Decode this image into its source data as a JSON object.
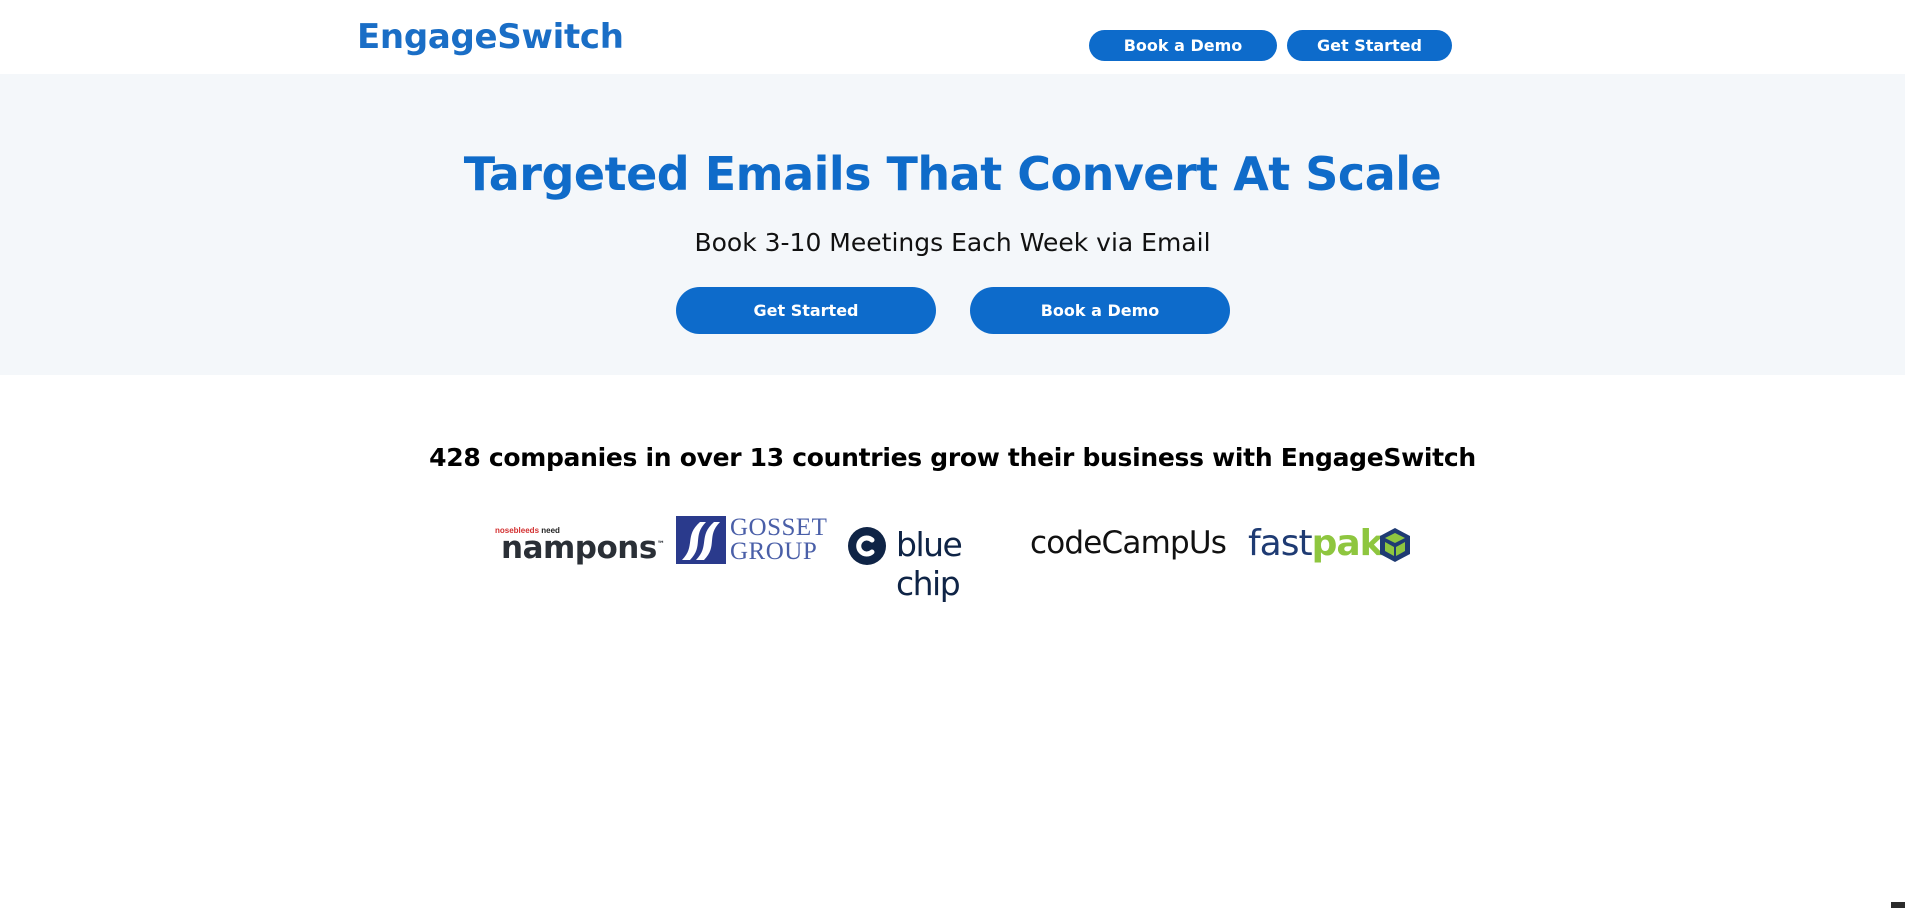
{
  "header": {
    "brand": "EngageSwitch",
    "nav": {
      "book_demo": "Book a Demo",
      "get_started": "Get Started"
    }
  },
  "hero": {
    "title": "Targeted Emails That Convert At Scale",
    "subtitle": "Book 3-10 Meetings Each Week via Email",
    "buttons": {
      "get_started": "Get Started",
      "book_demo": "Book a Demo"
    }
  },
  "social_proof": {
    "headline": "428 companies in over 13 countries grow their business with EngageSwitch",
    "logos": {
      "nampons": {
        "tagline_red": "nosebleeds",
        "tagline_dark": "need",
        "name": "nampons",
        "tm": "™"
      },
      "gosset": {
        "line1": "GOSSET",
        "line2": "GROUP"
      },
      "bluechip": {
        "name": "blue chip"
      },
      "codecampus": {
        "name": "codeCampUs"
      },
      "fastpak": {
        "part1": "fast",
        "part2": "pak"
      }
    }
  },
  "colors": {
    "brand_blue": "#1a6ec6",
    "button_blue": "#0d6bcb",
    "hero_bg": "#f4f7fa",
    "fastpak_green": "#8ec63f"
  }
}
